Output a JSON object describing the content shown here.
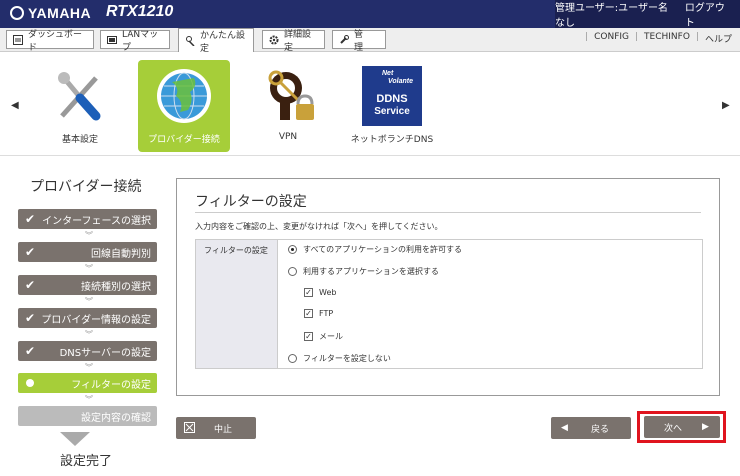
{
  "header": {
    "brand": "YAMAHA",
    "model": "RTX1210",
    "user_label": "管理ユーザー:ユーザー名なし",
    "logout_label": "ログアウト"
  },
  "menu": {
    "tabs": [
      {
        "label": "ダッシュボード"
      },
      {
        "label": "LANマップ"
      },
      {
        "label": "かんたん設定"
      },
      {
        "label": "詳細設定"
      },
      {
        "label": "管　理"
      }
    ],
    "links": [
      "CONFIG",
      "TECHINFO",
      "ヘルプ"
    ]
  },
  "categories": [
    {
      "label": "基本設定"
    },
    {
      "label": "プロバイダー接続"
    },
    {
      "label": "VPN"
    },
    {
      "label": "ネットボランチDNS"
    }
  ],
  "ddns_logo": {
    "line1": "Net",
    "line2": "Volante",
    "line3": "DDNS",
    "line4": "Service"
  },
  "sidebar": {
    "title": "プロバイダー接続",
    "steps": [
      {
        "label": "インターフェースの選択"
      },
      {
        "label": "回線自動判別"
      },
      {
        "label": "接続種別の選択"
      },
      {
        "label": "プロバイダー情報の設定"
      },
      {
        "label": "DNSサーバーの設定"
      },
      {
        "label": "フィルターの設定"
      },
      {
        "label": "設定内容の確認"
      }
    ],
    "done_label": "設定完了"
  },
  "panel": {
    "title": "フィルターの設定",
    "note": "入力内容をご確認の上、変更がなければ「次へ」を押してください。",
    "field_label": "フィルターの設定",
    "options": [
      {
        "label": "すべてのアプリケーションの利用を許可する"
      },
      {
        "label": "利用するアプリケーションを選択する"
      },
      {
        "label": "フィルターを設定しない"
      }
    ],
    "apps": [
      {
        "label": "Web"
      },
      {
        "label": "FTP"
      },
      {
        "label": "メール"
      }
    ]
  },
  "buttons": {
    "cancel": "中止",
    "back": "戻る",
    "next": "次へ"
  },
  "icons": {
    "prev": "chevron-left-icon",
    "next": "chevron-right-icon"
  }
}
